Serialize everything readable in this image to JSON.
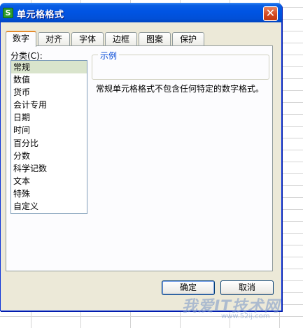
{
  "dialog": {
    "title": "单元格格式",
    "icon_glyph": "S",
    "close_glyph": "✕"
  },
  "tabs": [
    {
      "label": "数字",
      "active": true
    },
    {
      "label": "对齐",
      "active": false
    },
    {
      "label": "字体",
      "active": false
    },
    {
      "label": "边框",
      "active": false
    },
    {
      "label": "图案",
      "active": false
    },
    {
      "label": "保护",
      "active": false
    }
  ],
  "category": {
    "label": "分类(C):",
    "items": [
      "常规",
      "数值",
      "货币",
      "会计专用",
      "日期",
      "时间",
      "百分比",
      "分数",
      "科学记数",
      "文本",
      "特殊",
      "自定义"
    ],
    "selected": "常规"
  },
  "sample": {
    "legend": "示例"
  },
  "description": "常规单元格格式不包含任何特定的数字格式。",
  "buttons": {
    "ok": "确定",
    "cancel": "取消"
  },
  "watermark": {
    "text": "我爱IT技术网",
    "url": "www.52ij.com"
  },
  "colors": {
    "titlebar": "#0054e3",
    "dialog_bg": "#ece9d8",
    "legend_text": "#0046d5",
    "selected_item": "#d9e4cc",
    "active_tab_accent": "#e68b2c"
  }
}
